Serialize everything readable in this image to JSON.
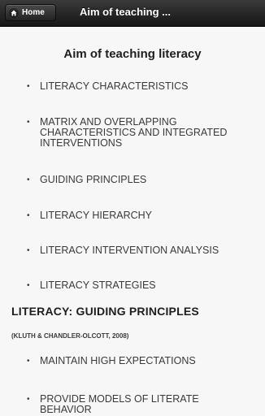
{
  "header": {
    "home_label": "Home",
    "title": "Aim of teaching ..."
  },
  "main": {
    "title": "Aim of teaching literacy",
    "items": [
      {
        "label": "LITERACY CHARACTERISTICS"
      },
      {
        "label": "MATRIX AND OVERLAPPING CHARACTERISTICS AND INTEGRATED INTERVENTIONS"
      },
      {
        "label": "GUIDING PRINCIPLES"
      },
      {
        "label": "LITERACY HIERARCHY"
      },
      {
        "label": "LITERACY INTERVENTION ANALYSIS"
      },
      {
        "label": "LITERACY STRATEGIES"
      }
    ],
    "section": {
      "heading": "LITERACY: GUIDING PRINCIPLES",
      "citation": "(KLUTH & CHANDLER-OLCOTT, 2008)",
      "items": [
        {
          "label": "MAINTAIN HIGH EXPECTATIONS"
        },
        {
          "label": "PROVIDE MODELS OF LITERATE BEHAVIOR"
        }
      ]
    }
  },
  "icons": {
    "home": "home-icon",
    "bullet": "bullet-icon"
  },
  "colors": {
    "header_bg": "#1e1e1e",
    "page_bg": "#f7f7f7",
    "text": "#3a3a3a"
  }
}
